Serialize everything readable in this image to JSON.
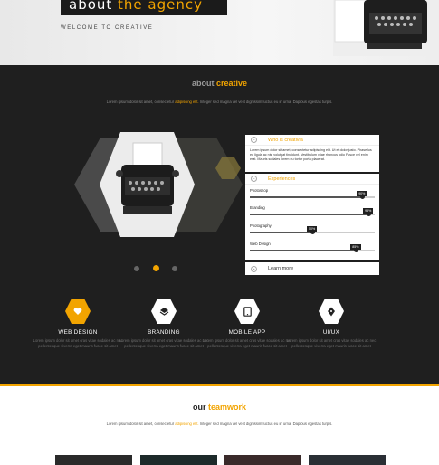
{
  "hero": {
    "title_plain": "about ",
    "title_accent": "the agency",
    "subtitle": "WELCOME TO CREATIVE"
  },
  "about": {
    "title_plain": "about ",
    "title_accent": "creative",
    "text_a": "Lorem ipsum dolor sit amet, consectetur ",
    "text_hl": "adipiscing elit.",
    "text_b": " Integer sed magna vel velit dignissim luctus eu in urna. Dapibus egestas turpis."
  },
  "accordion": {
    "item1_title": "Who is creativia",
    "item1_body": "Lorem ipsum dolor sit amet, consectetur adipiscing elit. Ut et dolor justo. Phasellus eu ligula ac nisl volutpat tincidunt. Vestibulum vitae rhoncus odio Fusce vel enim erat. Mauris sodales lorem eu tortor porta placerat.",
    "item2_title": "Experiences",
    "item3_title": "Learn more",
    "skills": [
      {
        "label": "Photoshop",
        "value": 90,
        "badge": "90%"
      },
      {
        "label": "Branding",
        "value": 95,
        "badge": "95%"
      },
      {
        "label": "Photography",
        "value": 50,
        "badge": "50%"
      },
      {
        "label": "Web Design",
        "value": 85,
        "badge": "85%"
      }
    ]
  },
  "services": [
    {
      "title": "WEB DESIGN",
      "icon": "heart-icon",
      "text": "Lorem ipsum dolor sit amet cras vitae sodales ac nec pellentesque viverra eget mauris fusce sit amet",
      "color": "#f2a400"
    },
    {
      "title": "BRANDING",
      "icon": "layers-icon",
      "text": "Lorem ipsum dolor sit amet cras vitae sodales ac nec pellentesque viverra eget mauris fusce sit amet",
      "color": "#ffffff"
    },
    {
      "title": "MOBILE APP",
      "icon": "tablet-icon",
      "text": "Lorem ipsum dolor sit amet cras vitae sodales ac nec pellentesque viverra eget mauris fusce sit amet",
      "color": "#ffffff"
    },
    {
      "title": "UI/UX",
      "icon": "pen-nib-icon",
      "text": "Lorem ipsum dolor sit amet cras vitae sodales ac nec pellentesque viverra eget mauris fusce sit amet",
      "color": "#ffffff"
    }
  ],
  "team": {
    "title_plain": "our ",
    "title_accent": "teamwork",
    "text_a": "Lorem ipsum dolor sit amet, consectetur ",
    "text_hl": "adipiscing elit.",
    "text_b": " Integer sed magna vel velit dignissim luctus eu in urna. Dapibus egestas turpis."
  },
  "colors": {
    "accent": "#f2a400",
    "dark": "#1f1f1f"
  }
}
